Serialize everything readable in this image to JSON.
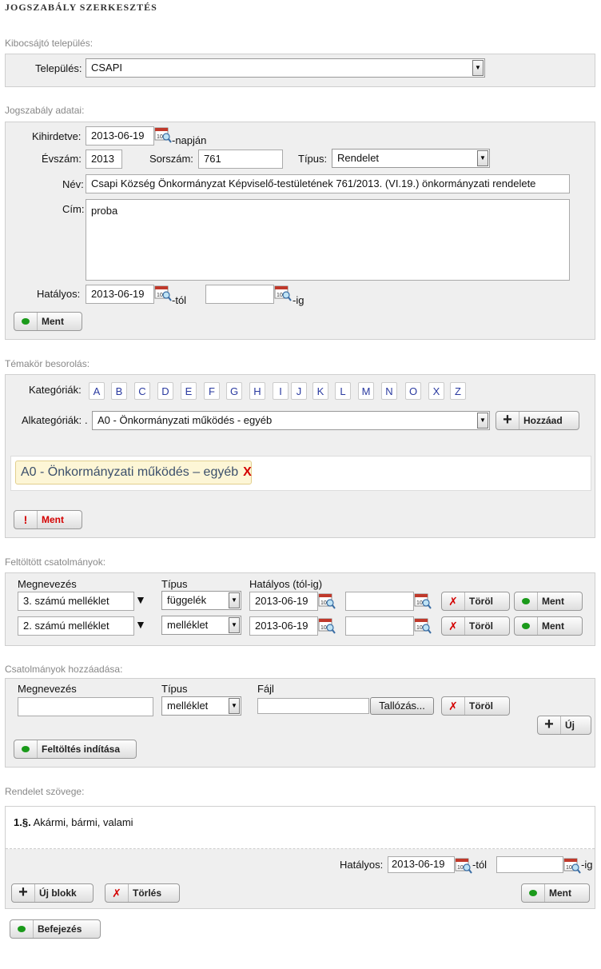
{
  "title": "JOGSZABÁLY SZERKESZTÉS",
  "issuer": {
    "section_title": "Kibocsájtó település:",
    "settlement_label": "Település:",
    "settlement_value": "CSAPI"
  },
  "law": {
    "section_title": "Jogszabály adatai:",
    "published_label": "Kihirdetve:",
    "published_value": "2013-06-19",
    "published_suffix": "-napján",
    "year_label": "Évszám:",
    "year_value": "2013",
    "number_label": "Sorszám:",
    "number_value": "761",
    "type_label": "Típus:",
    "type_value": "Rendelet",
    "name_label": "Név:",
    "name_value": "Csapi Község Önkormányzat Képviselő-testületének 761/2013. (VI.19.) önkormányzati rendelete",
    "subject_label": "Cím:",
    "subject_value": "proba",
    "effective_label": "Hatályos:",
    "effective_from": "2013-06-19",
    "from_suffix": "-tól",
    "effective_to": "",
    "to_suffix": "-ig",
    "save_label": "Ment"
  },
  "topic": {
    "section_title": "Témakör besorolás:",
    "categories_label": "Kategóriák:",
    "letters": [
      "A",
      "B",
      "C",
      "D",
      "E",
      "F",
      "G",
      "H",
      "I",
      "J",
      "K",
      "L",
      "M",
      "N",
      "O",
      "X",
      "Z"
    ],
    "subcategories_label": "Alkategóriák:",
    "subcategory_value": "A0 - Önkormányzati működés - egyéb",
    "add_label": "Hozzáad",
    "selected_tag": "A0 - Önkormányzati működés – egyéb",
    "selected_tag_remove": "X",
    "save_label": "Ment",
    "save_icon": "!"
  },
  "uploaded": {
    "section_title": "Feltöltött csatolmányok:",
    "col_name": "Megnevezés",
    "col_type": "Típus",
    "col_valid": "Hatályos (tól-ig)",
    "rows": [
      {
        "name": "3. számú melléklet",
        "type": "függelék",
        "from": "2013-06-19",
        "to": "",
        "delete": "Töröl",
        "save": "Ment"
      },
      {
        "name": "2. számú melléklet",
        "type": "melléklet",
        "from": "2013-06-19",
        "to": "",
        "delete": "Töröl",
        "save": "Ment"
      }
    ]
  },
  "add_attach": {
    "section_title": "Csatolmányok hozzáadása:",
    "col_name": "Megnevezés",
    "col_type": "Típus",
    "col_file": "Fájl",
    "name_value": "",
    "type_value": "melléklet",
    "file_value": "",
    "browse_label": "Tallózás...",
    "delete_label": "Töröl",
    "new_label": "Új",
    "upload_label": "Feltöltés indítása"
  },
  "text": {
    "section_title": "Rendelet szövege:",
    "paragraph_num": "1.§.",
    "paragraph_text": "Akármi, bármi, valami",
    "effective_label": "Hatályos:",
    "effective_from": "2013-06-19",
    "from_suffix": "-tól",
    "effective_to": "",
    "to_suffix": "-ig",
    "new_block_label": "Új blokk",
    "delete_label": "Törlés",
    "save_label": "Ment"
  },
  "finish_label": "Befejezés",
  "colors": {
    "ok_dot": "#1a9a1a",
    "delete_x": "#d40000",
    "letter_link": "#2a3aa0",
    "warn_save": "#d40000"
  }
}
